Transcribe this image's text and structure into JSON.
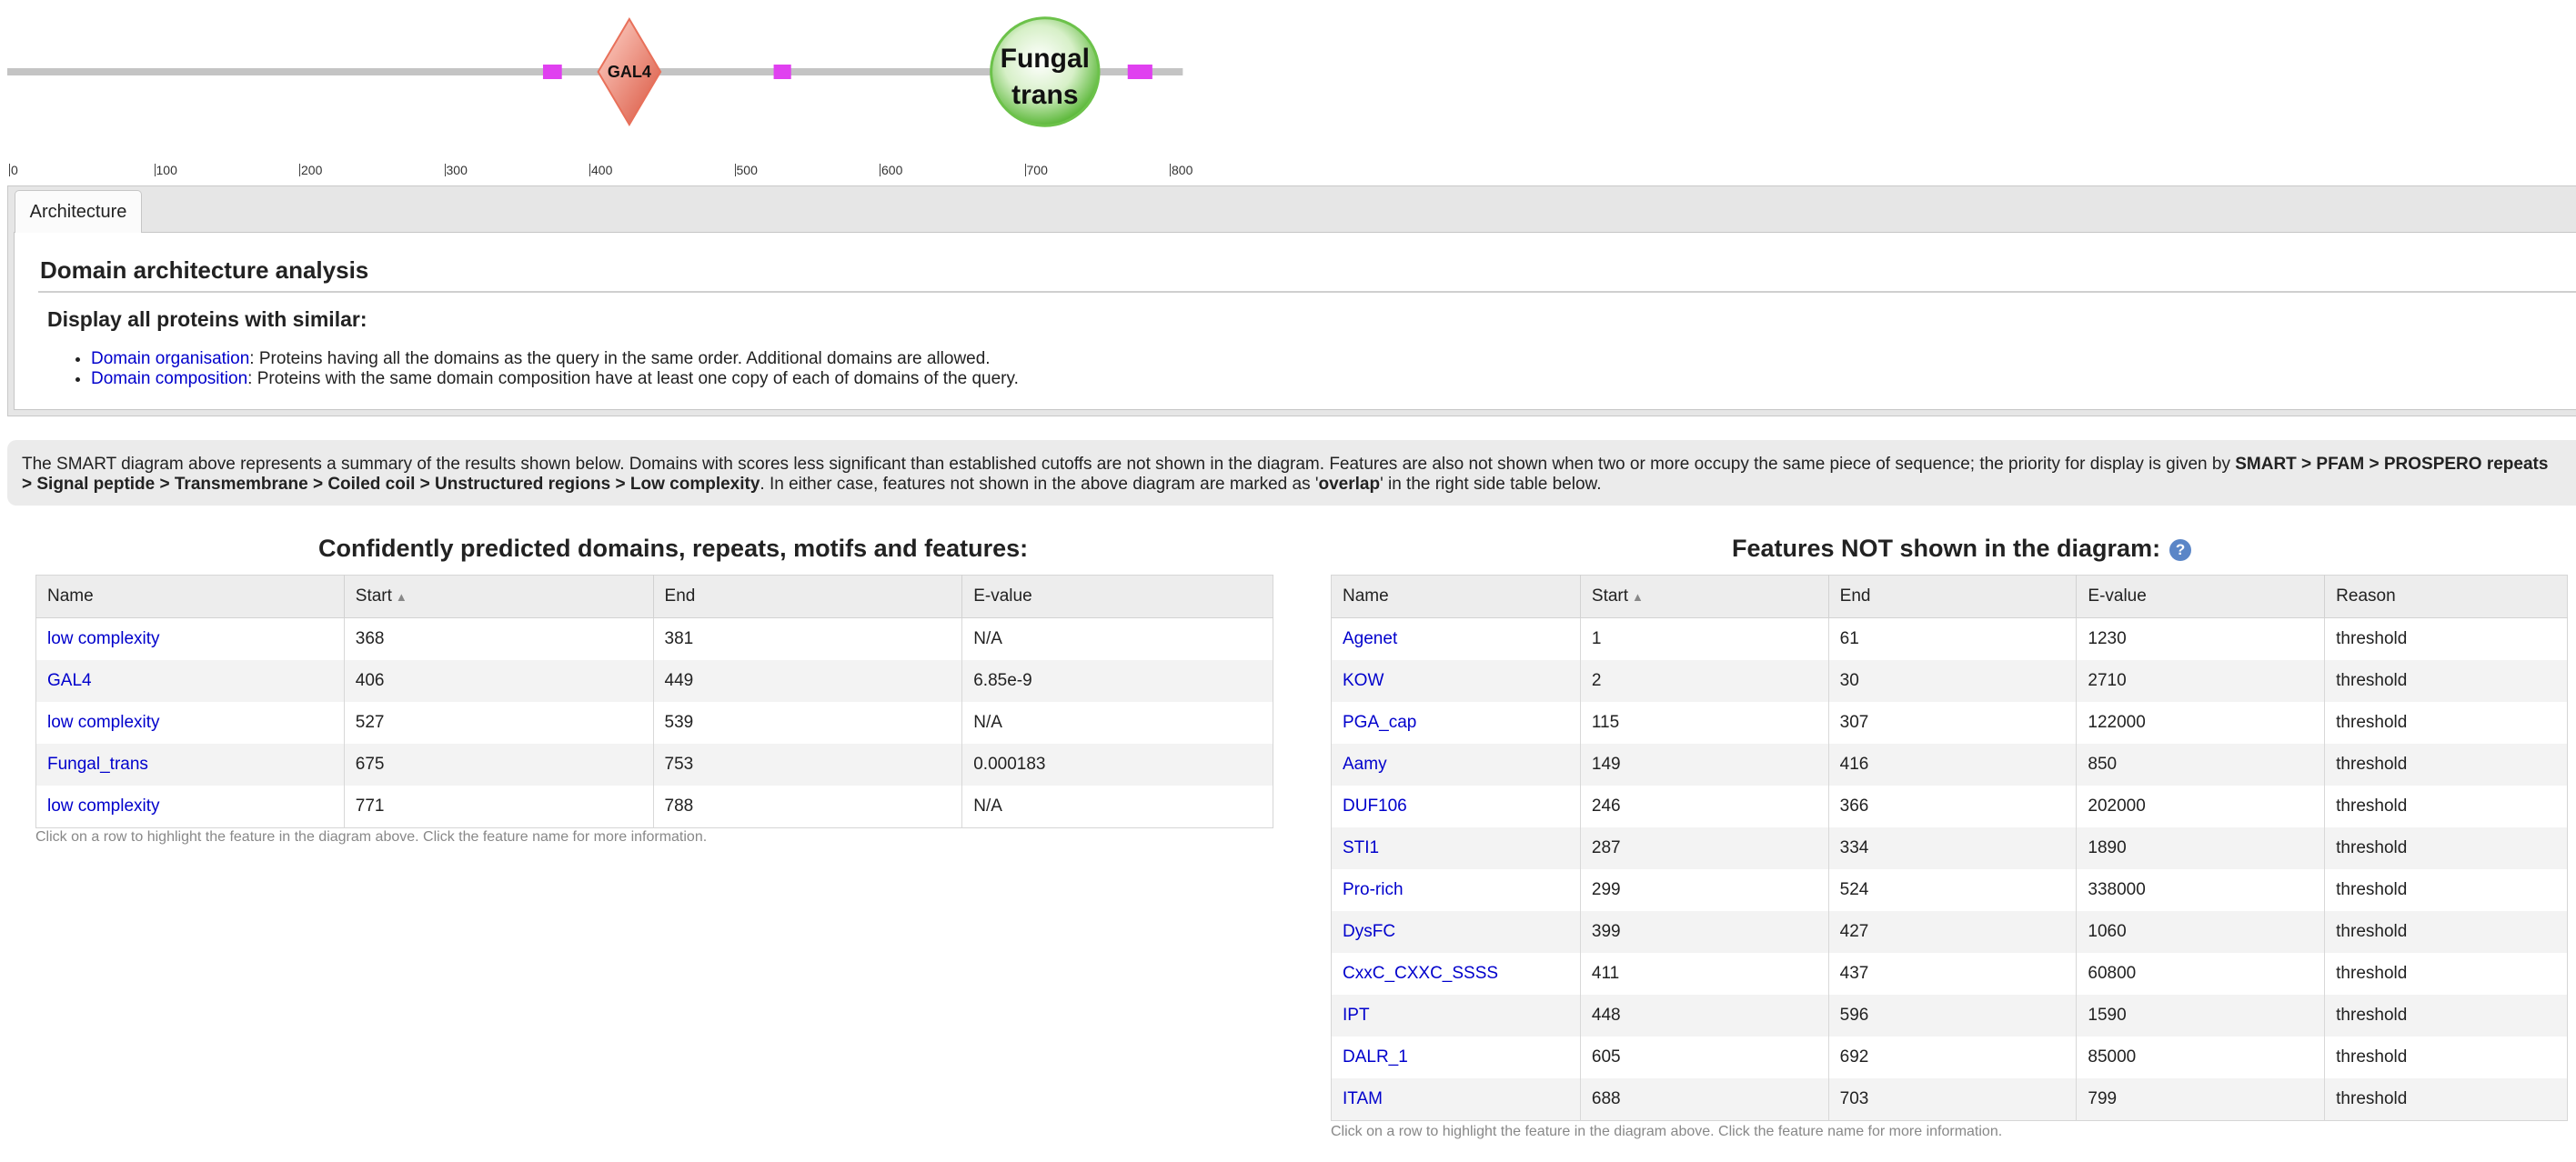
{
  "diagram": {
    "scale": {
      "min": 0,
      "max": 800,
      "ticks": [
        "0",
        "100",
        "200",
        "300",
        "400",
        "500",
        "600",
        "700",
        "800"
      ]
    },
    "protein_length": 809,
    "domains": [
      {
        "type": "low complexity",
        "start": 368,
        "end": 381,
        "shape": "rectangle",
        "color": "#e040f0"
      },
      {
        "type": "GAL4",
        "start": 406,
        "end": 449,
        "shape": "diamond",
        "label": "GAL4",
        "color": "#e8705a"
      },
      {
        "type": "low complexity",
        "start": 527,
        "end": 539,
        "shape": "rectangle",
        "color": "#e040f0"
      },
      {
        "type": "Fungal_trans",
        "start": 675,
        "end": 753,
        "shape": "circle",
        "label_lines": [
          "Fungal",
          "trans"
        ],
        "color": "#6cc24a"
      },
      {
        "type": "low complexity",
        "start": 771,
        "end": 788,
        "shape": "rectangle",
        "color": "#e040f0"
      }
    ]
  },
  "tabs": {
    "architecture": "Architecture"
  },
  "architecture": {
    "title": "Domain architecture analysis",
    "subtitle": "Display all proteins with similar:",
    "items": [
      {
        "link": "Domain organisation",
        "text": ": Proteins having all the domains as the query in the same order. Additional domains are allowed."
      },
      {
        "link": "Domain composition",
        "text": ": Proteins with the same domain composition have at least one copy of each of domains of the query."
      }
    ]
  },
  "info": {
    "line1_plain": "The SMART diagram above represents a summary of the results shown below. Domains with scores less significant than established cutoffs are not shown in the diagram. Features are also not shown when two or more occupy the same piece of sequence; the priority for display is given by ",
    "line1_bold": "SMART > PFAM > PROSPERO repeats",
    "line2_bold": "> Signal peptide > Transmembrane > Coiled coil > Unstructured regions > Low complexity",
    "line2_plain_a": ". In either case, features not shown in the above diagram are marked as '",
    "line2_bold_b": "overlap",
    "line2_plain_c": "' in the right side table below."
  },
  "confident": {
    "title": "Confidently predicted domains, repeats, motifs and features:",
    "columns": [
      "Name",
      "Start",
      "End",
      "E-value"
    ],
    "sort_column": "Start",
    "rows": [
      {
        "name": "low complexity",
        "start": "368",
        "end": "381",
        "evalue": "N/A"
      },
      {
        "name": "GAL4",
        "start": "406",
        "end": "449",
        "evalue": "6.85e-9"
      },
      {
        "name": "low complexity",
        "start": "527",
        "end": "539",
        "evalue": "N/A"
      },
      {
        "name": "Fungal_trans",
        "start": "675",
        "end": "753",
        "evalue": "0.000183"
      },
      {
        "name": "low complexity",
        "start": "771",
        "end": "788",
        "evalue": "N/A"
      }
    ],
    "footnote": "Click on a row to highlight the feature in the diagram above. Click the feature name for more information."
  },
  "hidden": {
    "title": "Features NOT shown in the diagram:",
    "help": "?",
    "columns": [
      "Name",
      "Start",
      "End",
      "E-value",
      "Reason"
    ],
    "sort_column": "Start",
    "rows": [
      {
        "name": "Agenet",
        "start": "1",
        "end": "61",
        "evalue": "1230",
        "reason": "threshold"
      },
      {
        "name": "KOW",
        "start": "2",
        "end": "30",
        "evalue": "2710",
        "reason": "threshold"
      },
      {
        "name": "PGA_cap",
        "start": "115",
        "end": "307",
        "evalue": "122000",
        "reason": "threshold"
      },
      {
        "name": "Aamy",
        "start": "149",
        "end": "416",
        "evalue": "850",
        "reason": "threshold"
      },
      {
        "name": "DUF106",
        "start": "246",
        "end": "366",
        "evalue": "202000",
        "reason": "threshold"
      },
      {
        "name": "STI1",
        "start": "287",
        "end": "334",
        "evalue": "1890",
        "reason": "threshold"
      },
      {
        "name": "Pro-rich",
        "start": "299",
        "end": "524",
        "evalue": "338000",
        "reason": "threshold"
      },
      {
        "name": "DysFC",
        "start": "399",
        "end": "427",
        "evalue": "1060",
        "reason": "threshold"
      },
      {
        "name": "CxxC_CXXC_SSSS",
        "start": "411",
        "end": "437",
        "evalue": "60800",
        "reason": "threshold"
      },
      {
        "name": "IPT",
        "start": "448",
        "end": "596",
        "evalue": "1590",
        "reason": "threshold"
      },
      {
        "name": "DALR_1",
        "start": "605",
        "end": "692",
        "evalue": "85000",
        "reason": "threshold"
      },
      {
        "name": "ITAM",
        "start": "688",
        "end": "703",
        "evalue": "799",
        "reason": "threshold"
      }
    ],
    "footnote": "Click on a row to highlight the feature in the diagram above. Click the feature name for more information."
  }
}
